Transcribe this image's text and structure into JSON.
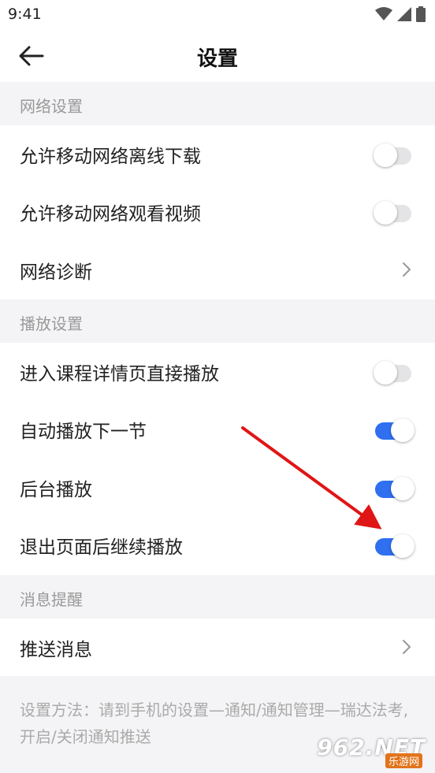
{
  "status_bar": {
    "time": "9:41"
  },
  "nav": {
    "title": "设置"
  },
  "sections": {
    "network": {
      "header": "网络设置",
      "offline_download": {
        "label": "允许移动网络离线下载",
        "enabled": false
      },
      "watch_video": {
        "label": "允许移动网络观看视频",
        "enabled": false
      },
      "diagnosis": {
        "label": "网络诊断"
      }
    },
    "playback": {
      "header": "播放设置",
      "direct_play": {
        "label": "进入课程详情页直接播放",
        "enabled": false
      },
      "autoplay_next": {
        "label": "自动播放下一节",
        "enabled": true
      },
      "background_play": {
        "label": "后台播放",
        "enabled": true
      },
      "continue_after_exit": {
        "label": "退出页面后继续播放",
        "enabled": true
      }
    },
    "notification": {
      "header": "消息提醒",
      "push": {
        "label": "推送消息"
      }
    }
  },
  "footer": {
    "hint": "设置方法：请到手机的设置—通知/通知管理—瑞达法考,开启/关闭通知推送"
  },
  "watermark": {
    "main": "962.NET",
    "sub": "乐游网"
  },
  "colors": {
    "toggle_on": "#2f6ff0",
    "toggle_off": "#e4e4e6",
    "section_bg": "#f4f4f6",
    "annotation_arrow": "#e01515"
  },
  "icons": {
    "back": "arrow-left-icon",
    "chevron": "chevron-right-icon",
    "wifi": "wifi-icon",
    "signal": "signal-icon",
    "battery": "battery-icon"
  }
}
